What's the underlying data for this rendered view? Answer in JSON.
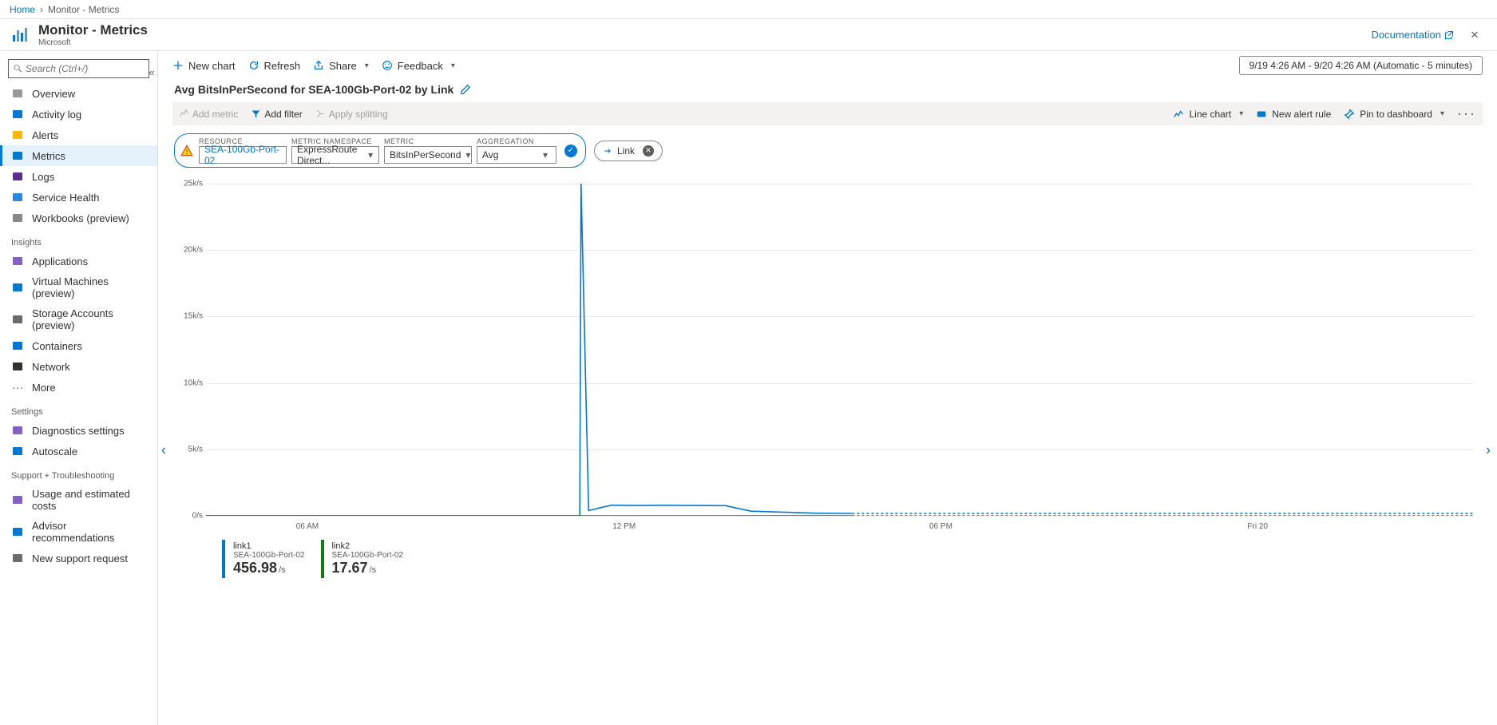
{
  "breadcrumb": {
    "home": "Home",
    "current": "Monitor - Metrics"
  },
  "header": {
    "title": "Monitor - Metrics",
    "subtitle": "Microsoft",
    "doc_link": "Documentation"
  },
  "search": {
    "placeholder": "Search (Ctrl+/)"
  },
  "sidebar": {
    "items": [
      {
        "label": "Overview",
        "sel": false
      },
      {
        "label": "Activity log",
        "sel": false
      },
      {
        "label": "Alerts",
        "sel": false
      },
      {
        "label": "Metrics",
        "sel": true
      },
      {
        "label": "Logs",
        "sel": false
      },
      {
        "label": "Service Health",
        "sel": false
      },
      {
        "label": "Workbooks (preview)",
        "sel": false
      }
    ],
    "insights_title": "Insights",
    "insights": [
      {
        "label": "Applications"
      },
      {
        "label": "Virtual Machines (preview)"
      },
      {
        "label": "Storage Accounts (preview)"
      },
      {
        "label": "Containers"
      },
      {
        "label": "Network"
      },
      {
        "label": "More"
      }
    ],
    "settings_title": "Settings",
    "settings": [
      {
        "label": "Diagnostics settings"
      },
      {
        "label": "Autoscale"
      }
    ],
    "support_title": "Support + Troubleshooting",
    "support": [
      {
        "label": "Usage and estimated costs"
      },
      {
        "label": "Advisor recommendations"
      },
      {
        "label": "New support request"
      }
    ]
  },
  "toolbar": {
    "new_chart": "New chart",
    "refresh": "Refresh",
    "share": "Share",
    "feedback": "Feedback",
    "timerange": "9/19 4:26 AM - 9/20 4:26 AM (Automatic - 5 minutes)"
  },
  "chart_title": "Avg BitsInPerSecond for SEA-100Gb-Port-02 by Link",
  "cmdbar": {
    "add_metric": "Add metric",
    "add_filter": "Add filter",
    "apply_splitting": "Apply splitting",
    "line_chart": "Line chart",
    "new_alert": "New alert rule",
    "pin": "Pin to dashboard"
  },
  "picker": {
    "resource_label": "RESOURCE",
    "resource_value": "SEA-100Gb-Port-02",
    "namespace_label": "METRIC NAMESPACE",
    "namespace_value": "ExpressRoute Direct...",
    "metric_label": "METRIC",
    "metric_value": "BitsInPerSecond",
    "agg_label": "AGGREGATION",
    "agg_value": "Avg"
  },
  "filter_chip": {
    "label": "Link"
  },
  "chart_data": {
    "type": "line",
    "title": "Avg BitsInPerSecond for SEA-100Gb-Port-02 by Link",
    "ylabel": "/s",
    "ylim": [
      0,
      25000
    ],
    "y_ticks": [
      "0/s",
      "5k/s",
      "10k/s",
      "15k/s",
      "20k/s",
      "25k/s"
    ],
    "x_labels": [
      "06 AM",
      "12 PM",
      "06 PM",
      "Fri 20"
    ],
    "series": [
      {
        "name": "link1",
        "resource": "SEA-100Gb-Port-02",
        "color": "#0078d4",
        "summary_value": "456.98",
        "summary_unit": "/s",
        "segments": [
          {
            "from": 0.0,
            "to": 0.295,
            "style": "solid",
            "points": [
              [
                0.0,
                0
              ],
              [
                0.295,
                0
              ]
            ]
          },
          {
            "from": 0.295,
            "to": 0.51,
            "style": "solid",
            "points": [
              [
                0.295,
                0
              ],
              [
                0.296,
                25000
              ],
              [
                0.302,
                400
              ],
              [
                0.32,
                800
              ],
              [
                0.34,
                780
              ],
              [
                0.36,
                790
              ],
              [
                0.41,
                760
              ],
              [
                0.43,
                350
              ],
              [
                0.48,
                200
              ],
              [
                0.51,
                180
              ]
            ]
          },
          {
            "from": 0.51,
            "to": 1.0,
            "style": "dashed",
            "points": [
              [
                0.51,
                180
              ],
              [
                1.0,
                180
              ]
            ]
          }
        ]
      },
      {
        "name": "link2",
        "resource": "SEA-100Gb-Port-02",
        "color": "#107c10",
        "summary_value": "17.67",
        "summary_unit": "/s",
        "segments": [
          {
            "from": 0.0,
            "to": 0.51,
            "style": "solid",
            "points": [
              [
                0.0,
                0
              ],
              [
                0.51,
                0
              ]
            ]
          },
          {
            "from": 0.51,
            "to": 1.0,
            "style": "dashed",
            "points": [
              [
                0.51,
                0
              ],
              [
                1.0,
                0
              ]
            ]
          }
        ]
      }
    ]
  }
}
